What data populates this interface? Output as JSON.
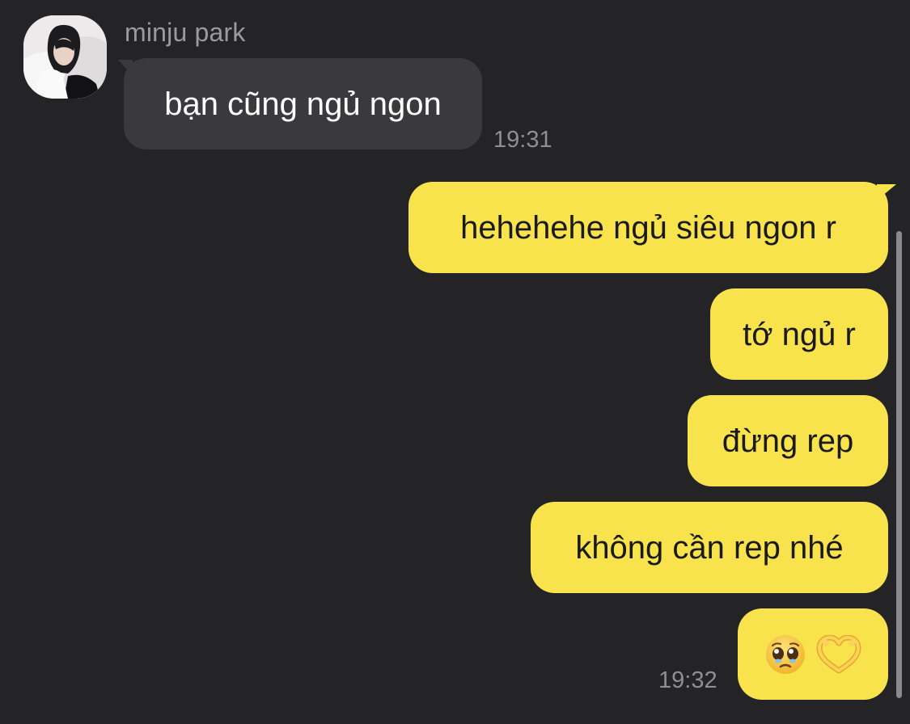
{
  "chat": {
    "sender_name": "minju park",
    "incoming": [
      {
        "text": "bạn cũng ngủ ngon",
        "time": "19:31"
      }
    ],
    "outgoing": [
      {
        "text": "hehehehe ngủ siêu ngon r"
      },
      {
        "text": "tớ ngủ r"
      },
      {
        "text": "đừng rep"
      },
      {
        "text": "không cần rep nhé"
      },
      {
        "emoji": [
          "pleading-face",
          "heart-hands"
        ],
        "time": "19:32"
      }
    ]
  },
  "colors": {
    "background": "#242426",
    "incoming_bubble": "#3a3a3c",
    "outgoing_bubble": "#f8e34c",
    "timestamp": "#8e8e93",
    "sender_name": "#9a9aa0"
  }
}
